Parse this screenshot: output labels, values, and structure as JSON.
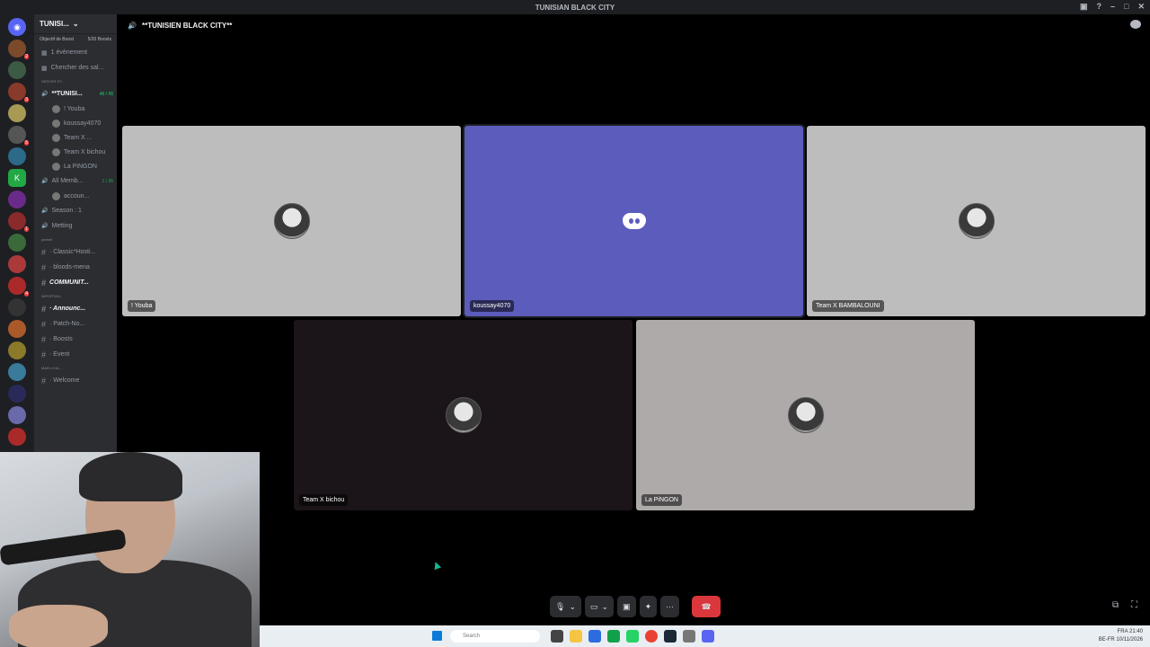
{
  "window": {
    "title": "TUNISIAN BLACK CITY"
  },
  "guild": {
    "name": "TUNISI...",
    "boost": {
      "label": "Objectif de Boost",
      "value": "5/20 Boosts"
    }
  },
  "channels": [
    {
      "type": "item",
      "icon": "calendar-icon",
      "label": "1 évènement"
    },
    {
      "type": "item",
      "icon": "browse-icon",
      "label": "Chercher des sal..."
    },
    {
      "type": "sep",
      "label": "SERVER ST..."
    },
    {
      "type": "voice-active",
      "label": "**TUNISI...",
      "count": "40 / 45"
    },
    {
      "type": "user",
      "label": "! Youba"
    },
    {
      "type": "user",
      "label": "koussay4070"
    },
    {
      "type": "user",
      "label": "Team X ..."
    },
    {
      "type": "user",
      "label": "Team X bichou"
    },
    {
      "type": "user",
      "label": "La PiNGON"
    },
    {
      "type": "voice",
      "label": "All Memb...",
      "count": "1 / 36"
    },
    {
      "type": "user",
      "label": "accoun..."
    },
    {
      "type": "voice",
      "label": "Season : 1"
    },
    {
      "type": "voice",
      "label": "Metting"
    },
    {
      "type": "sep",
      "label": "partner"
    },
    {
      "type": "text",
      "label": "· Classic*Hosti..."
    },
    {
      "type": "text",
      "label": "· bloods-mena"
    },
    {
      "type": "text-bold",
      "label": "COMMUNIT..."
    },
    {
      "type": "sep",
      "label": "IMPORTAN..."
    },
    {
      "type": "text-bold",
      "label": "· Announc..."
    },
    {
      "type": "text",
      "label": "· Patch-No..."
    },
    {
      "type": "text",
      "label": "· Boosts"
    },
    {
      "type": "text",
      "label": "· Event"
    },
    {
      "type": "sep",
      "label": "MAIN CHA..."
    },
    {
      "type": "text",
      "label": "· Welcome"
    }
  ],
  "voice_header": {
    "title": "**TUNISIEN BLACK CITY**"
  },
  "participants": [
    {
      "name": "! Youba",
      "bg": "#bdbdbd",
      "style": "avatar"
    },
    {
      "name": "koussay4070",
      "bg": "#5b5cbc",
      "style": "discord"
    },
    {
      "name": "Team X BAMBALOUNI",
      "bg": "#bdbdbd",
      "style": "avatar"
    },
    {
      "name": "Team X bichou",
      "bg": "#1b1418",
      "style": "avatar"
    },
    {
      "name": "La PiNGON",
      "bg": "#afaaaa",
      "style": "avatar"
    }
  ],
  "controls": {
    "mic": "mic-icon",
    "camera": "camera-icon",
    "screen": "screenshare-icon",
    "activities": "activities-icon",
    "more": "···",
    "leave": "phone-hangup-icon"
  },
  "taskbar": {
    "search_placeholder": "Search",
    "lang": "FRA",
    "region": "BE-FR",
    "time": "21:40",
    "date": "10/11/2026"
  },
  "colors": {
    "accent": "#5b5cbc",
    "danger": "#da373c",
    "online": "#23a55a"
  }
}
